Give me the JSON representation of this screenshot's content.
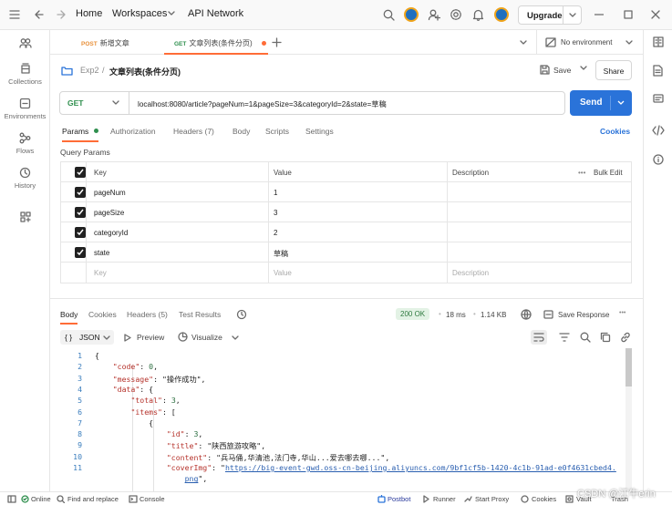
{
  "topbar": {
    "home": "Home",
    "workspaces": "Workspaces",
    "api_network": "API Network",
    "upgrade": "Upgrade"
  },
  "sidebar": {
    "items": [
      {
        "label": ""
      },
      {
        "label": "Collections"
      },
      {
        "label": "Environments"
      },
      {
        "label": "Flows"
      },
      {
        "label": "History"
      },
      {
        "label": ""
      }
    ]
  },
  "tabs": [
    {
      "method": "POST",
      "name": "新增文章"
    },
    {
      "method": "GET",
      "name": "文章列表(条件分页)"
    }
  ],
  "environment": "No environment",
  "breadcrumb": {
    "collection": "Exp2",
    "sep": "/",
    "request": "文章列表(条件分页)"
  },
  "actions": {
    "save": "Save",
    "share": "Share"
  },
  "request": {
    "method": "GET",
    "url": "localhost:8080/article?pageNum=1&pageSize=3&categoryId=2&state=草稿",
    "send": "Send"
  },
  "request_tabs": [
    "Params",
    "Authorization",
    "Headers (7)",
    "Body",
    "Scripts",
    "Settings"
  ],
  "cookies_link": "Cookies",
  "query_params": {
    "title": "Query Params",
    "headers": {
      "key": "Key",
      "value": "Value",
      "description": "Description",
      "bulk_edit": "Bulk Edit"
    },
    "rows": [
      {
        "key": "pageNum",
        "value": "1"
      },
      {
        "key": "pageSize",
        "value": "3"
      },
      {
        "key": "categoryId",
        "value": "2"
      },
      {
        "key": "state",
        "value": "草稿"
      }
    ],
    "placeholder": {
      "key": "Key",
      "value": "Value",
      "description": "Description"
    }
  },
  "response": {
    "tabs": [
      "Body",
      "Cookies",
      "Headers (5)",
      "Test Results"
    ],
    "status": "200 OK",
    "time": "18 ms",
    "size": "1.14 KB",
    "save_response": "Save Response",
    "format": "JSON",
    "preview": "Preview",
    "visualize": "Visualize",
    "lines": [
      {
        "n": "1",
        "t": "{"
      },
      {
        "n": "2",
        "t": "    \"code\": 0,"
      },
      {
        "n": "3",
        "t": "    \"message\": \"操作成功\","
      },
      {
        "n": "4",
        "t": "    \"data\": {"
      },
      {
        "n": "5",
        "t": "        \"total\": 3,"
      },
      {
        "n": "6",
        "t": "        \"items\": ["
      },
      {
        "n": "7",
        "t": "            {"
      },
      {
        "n": "8",
        "t": "                \"id\": 3,"
      },
      {
        "n": "9",
        "t": "                \"title\": \"陕西旅游攻略\","
      },
      {
        "n": "10",
        "t": "                \"content\": \"兵马俑,华清池,法门寺,华山...爱去哪去哪...\","
      },
      {
        "n": "11",
        "t": "                \"coverImg\": \"https://big-event-gwd.oss-cn-beijing.aliyuncs.com/9bf1cf5b-1420-4c1b-91ad-e0f4631cbed4."
      },
      {
        "n": "",
        "t": "                    png\","
      }
    ]
  },
  "statusbar": {
    "online": "Online",
    "find": "Find and replace",
    "console": "Console",
    "postbot": "Postbot",
    "runner": "Runner",
    "proxy": "Start Proxy",
    "cookies": "Cookies",
    "vault": "Vault",
    "trash": "Trash",
    "watermark": "CSDN @江牛erin"
  }
}
